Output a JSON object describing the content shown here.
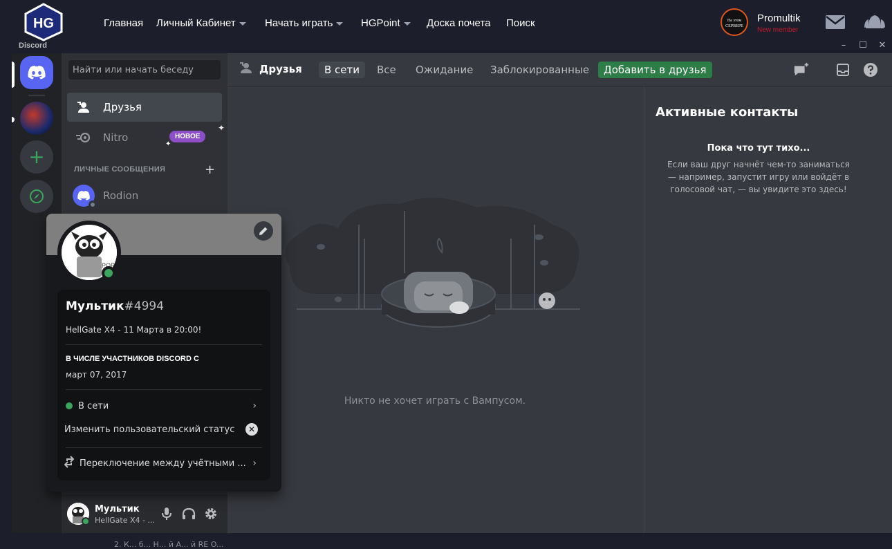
{
  "site": {
    "logo_text": "HG",
    "nav": [
      {
        "label": "Главная",
        "dropdown": false
      },
      {
        "label": "Личный Кабинет",
        "dropdown": true
      },
      {
        "label": "Начать играть",
        "dropdown": true
      },
      {
        "label": "HGPoint",
        "dropdown": true
      },
      {
        "label": "Доска почета",
        "dropdown": false
      },
      {
        "label": "Поиск",
        "dropdown": false
      }
    ],
    "user": {
      "badge_text": "На этом СЕРВЕРЕ",
      "name": "Promultik",
      "role": "New member"
    },
    "icons": [
      "mail-icon",
      "bell-icon"
    ]
  },
  "window": {
    "title": "Discord",
    "controls": [
      "–",
      "☐",
      "✕"
    ]
  },
  "sidebar": {
    "search_placeholder": "Найти или начать беседу",
    "friends_label": "Друзья",
    "nitro_label": "Nitro",
    "new_badge": "НОВОЕ",
    "dm_header": "ЛИЧНЫЕ СООБЩЕНИЯ",
    "dms": [
      {
        "name": "Rodion"
      }
    ]
  },
  "user_panel": {
    "name": "Мультик",
    "sub": "HellGate X4 - ..."
  },
  "topbar": {
    "title": "Друзья",
    "tabs": {
      "online": "В сети",
      "all": "Все",
      "pending": "Ожидание",
      "blocked": "Заблокированные",
      "add": "Добавить в друзья"
    }
  },
  "main": {
    "empty_text": "Никто не хочет играть с Вампусом."
  },
  "active": {
    "title": "Активные контакты",
    "quiet_title": "Пока что тут тихо...",
    "quiet_body": "Если ваш друг начнёт чем-то заниматься — например, запустит игру или войдёт в голосовой чат, — вы увидите это здесь!"
  },
  "profile": {
    "name": "Мультик",
    "discriminator": "#4994",
    "custom_status": "HellGate X4 - 11 Марта в 20:00!",
    "member_since_title": "В ЧИСЛЕ УЧАСТНИКОВ DISCORD С",
    "member_since_date": "март 07, 2017",
    "status": "В сети",
    "change_status": "Изменить пользовательский статус",
    "switch_accounts": "Переключение между учётными ..."
  },
  "bottom_text": "2. К... б... Н... й А... й RE O...",
  "colors": {
    "blurple": "#5865f2",
    "green": "#3ba55d",
    "add_friend": "#2d7d46",
    "nitro_badge": "#8d4fc8",
    "role": "#c01c28"
  }
}
